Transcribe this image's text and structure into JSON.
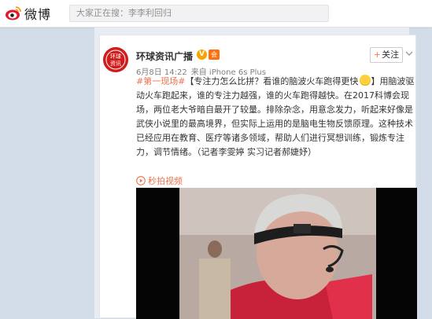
{
  "header": {
    "brand": "微博",
    "search_placeholder": "大家正在搜：李李利回归"
  },
  "post": {
    "author": "环球资讯广播",
    "avatar_text": "环球资讯",
    "verified_badge": "V",
    "member_badge": "会",
    "follow_label": "关注",
    "date": "6月8日 14:22",
    "source": "来自 iPhone 6s Plus",
    "hashtag": "#第一现场#",
    "headline": "【专注力怎么比拼？看谁的脑波火车跑得更快",
    "headline_end": "】",
    "body": "用脑波驱动火车跑起来，谁的专注力越强，谁的火车跑得越快。在2017科博会现场，两位老大爷暗自最开了较量。排除杂念，用意念发力，听起来好像是武侠小说里的最高境界，但实际上运用的是脑电生物反馈原理。这种技术已经应用在教育、医疗等诸多领域，帮助人们进行冥想训练，锻炼专注力，调节情绪。（记者李雯婷 实习记者郝婕妤）",
    "video_label": "秒拍视频"
  },
  "colors": {
    "link": "#eb7350",
    "follow_plus": "#ff8140",
    "page_bg": "#d3ddea"
  },
  "icons": [
    "weibo-eye-icon",
    "verified-icon",
    "member-icon",
    "chevron-down-icon",
    "play-icon",
    "smile-emoji-icon"
  ]
}
